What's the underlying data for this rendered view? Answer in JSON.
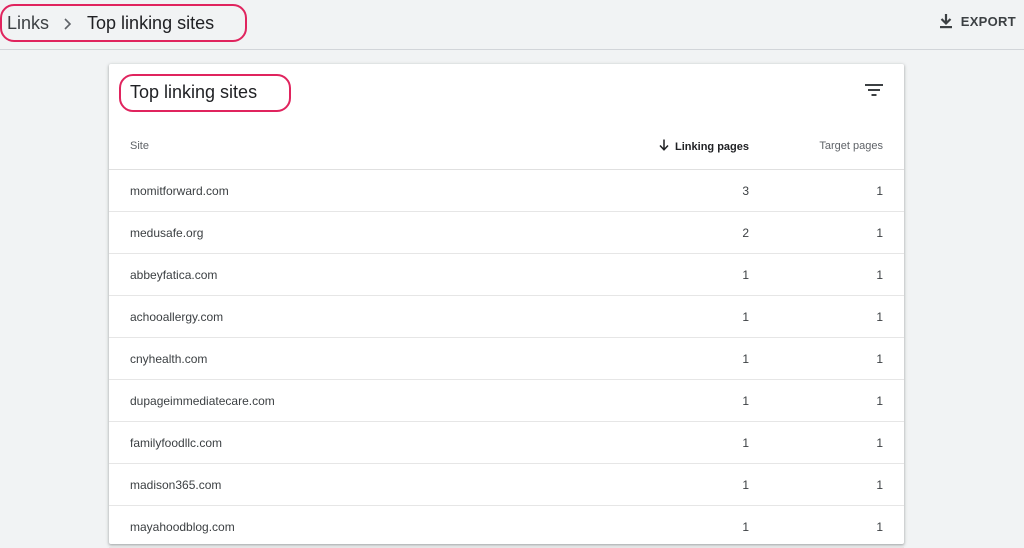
{
  "breadcrumb": {
    "parent": "Links",
    "separator": ">",
    "current": "Top linking sites"
  },
  "toolbar": {
    "export_label": "EXPORT",
    "export_icon": "download-icon"
  },
  "card": {
    "title": "Top linking sites",
    "filter_icon": "filter-icon"
  },
  "table": {
    "columns": {
      "site": "Site",
      "linking_pages": "Linking pages",
      "target_pages": "Target pages"
    },
    "sort_icon": "arrow-down-icon",
    "rows": [
      {
        "site": "momitforward.com",
        "linking_pages": "3",
        "target_pages": "1"
      },
      {
        "site": "medusafe.org",
        "linking_pages": "2",
        "target_pages": "1"
      },
      {
        "site": "abbeyfatica.com",
        "linking_pages": "1",
        "target_pages": "1"
      },
      {
        "site": "achooallergy.com",
        "linking_pages": "1",
        "target_pages": "1"
      },
      {
        "site": "cnyhealth.com",
        "linking_pages": "1",
        "target_pages": "1"
      },
      {
        "site": "dupageimmediatecare.com",
        "linking_pages": "1",
        "target_pages": "1"
      },
      {
        "site": "familyfoodllc.com",
        "linking_pages": "1",
        "target_pages": "1"
      },
      {
        "site": "madison365.com",
        "linking_pages": "1",
        "target_pages": "1"
      },
      {
        "site": "mayahoodblog.com",
        "linking_pages": "1",
        "target_pages": "1"
      }
    ]
  },
  "colors": {
    "highlight": "#e0245e",
    "background": "#f1f3f4",
    "card": "#ffffff"
  }
}
